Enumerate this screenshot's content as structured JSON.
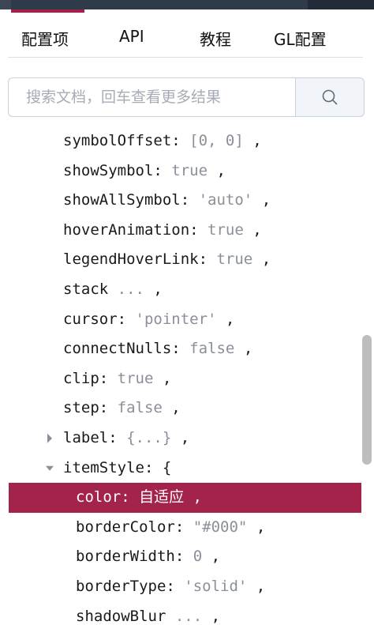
{
  "tabs": [
    {
      "label": "配置项",
      "active": true
    },
    {
      "label": "API",
      "active": false
    },
    {
      "label": "教程",
      "active": false
    },
    {
      "label": "GL配置",
      "active": false
    }
  ],
  "search": {
    "placeholder": "搜索文档，回车查看更多结果",
    "value": "",
    "button_icon": "search-icon"
  },
  "accent_color": "#a3234b",
  "tree": {
    "rows": [
      {
        "key": "symbolOffset",
        "sep": ": ",
        "value": "[0, 0]",
        "suffix": " ,"
      },
      {
        "key": "showSymbol",
        "sep": ": ",
        "value": "true",
        "suffix": " ,"
      },
      {
        "key": "showAllSymbol",
        "sep": ": ",
        "value": "'auto'",
        "suffix": " ,"
      },
      {
        "key": "hoverAnimation",
        "sep": ": ",
        "value": "true",
        "suffix": " ,"
      },
      {
        "key": "legendHoverLink",
        "sep": ": ",
        "value": "true",
        "suffix": " ,"
      },
      {
        "key": "stack",
        "sep": " ",
        "value": "...",
        "suffix": " ,"
      },
      {
        "key": "cursor",
        "sep": ": ",
        "value": "'pointer'",
        "suffix": " ,"
      },
      {
        "key": "connectNulls",
        "sep": ": ",
        "value": "false",
        "suffix": " ,"
      },
      {
        "key": "clip",
        "sep": ": ",
        "value": "true",
        "suffix": " ,"
      },
      {
        "key": "step",
        "sep": ": ",
        "value": "false",
        "suffix": " ,"
      },
      {
        "key": "label",
        "sep": ": ",
        "value": "{...}",
        "suffix": " ,",
        "caret": "right"
      },
      {
        "key": "itemStyle",
        "sep": ": ",
        "value": "{",
        "suffix": "",
        "caret": "down"
      },
      {
        "key": "color",
        "sep": ": ",
        "value": "自适应",
        "suffix": " ,",
        "selected": true
      },
      {
        "key": "borderColor",
        "sep": ": ",
        "value": "\"#000\"",
        "suffix": " ,"
      },
      {
        "key": "borderWidth",
        "sep": ": ",
        "value": "0",
        "suffix": " ,"
      },
      {
        "key": "borderType",
        "sep": ": ",
        "value": "'solid'",
        "suffix": " ,"
      },
      {
        "key": "shadowBlur",
        "sep": " ",
        "value": "...",
        "suffix": " ,"
      }
    ]
  },
  "scroll": {
    "position": 0.42
  }
}
